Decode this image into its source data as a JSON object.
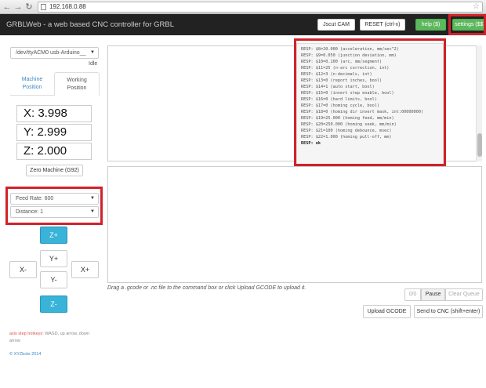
{
  "browser": {
    "url": "192.168.0.88"
  },
  "navbar": {
    "brand": "GRBLWeb - a web based CNC controller for GRBL",
    "buttons": {
      "jscut": "Jscut CAM",
      "reset": "RESET (ctrl-x)",
      "help": "help ($)",
      "settings": "settings ($$)"
    }
  },
  "sidebar": {
    "port": "/dev/ttyACM0 usb-Arduino__",
    "status": "Idle",
    "tabs": {
      "machine": "Machine\nPosition",
      "working": "Working\nPosition"
    },
    "coords": {
      "x": "X: 3.998",
      "y": "Y: 2.999",
      "z": "Z: 2.000"
    },
    "zero_button": "Zero Machine (G92)",
    "feed_rate": "Feed Rate: 600",
    "distance": "Distance: 1",
    "jog": {
      "zplus": "Z+",
      "yplus": "Y+",
      "xminus": "X-",
      "xplus": "X+",
      "yminus": "Y-",
      "zminus": "Z-"
    },
    "hotkeys_label": "axis step hotkeys",
    "hotkeys_text": ": WASD, up arrow, down arrow",
    "copyright": "© XYZbots 2014"
  },
  "console": {
    "lines": [
      "RESP: $8=20.000 (acceleration, mm/sec^2)",
      "RESP: $9=0.050 (junction deviation, mm)",
      "RESP: $10=0.100 (arc, mm/segment)",
      "RESP: $11=25 (n-arc correction, int)",
      "RESP: $12=3 (n-decimals, int)",
      "RESP: $13=0 (report inches, bool)",
      "RESP: $14=1 (auto start, bool)",
      "RESP: $15=0 (invert step enable, bool)",
      "RESP: $16=0 (hard limits, bool)",
      "RESP: $17=0 (homing cycle, bool)",
      "RESP: $18=0 (homing dir invert mask, int:00000000)",
      "RESP: $19=25.000 (homing feed, mm/min)",
      "RESP: $20=250.000 (homing seek, mm/min)",
      "RESP: $21=100 (homing debounce, msec)",
      "RESP: $22=1.000 (homing pull-off, mm)",
      "RESP: ok"
    ]
  },
  "command": {
    "hint": "Drag a .gcode or .nc file to the command box or click Upload GCODE to upload it.",
    "queue_count": "0/0",
    "pause": "Pause",
    "clear_queue": "Clear Queue",
    "upload": "Upload GCODE",
    "send": "Send to CNC (shift+enter)"
  },
  "colors": {
    "highlight": "#d1222b",
    "navbar": "#222222",
    "jog_blue": "#39b3d7",
    "success": "#5cb85c"
  }
}
